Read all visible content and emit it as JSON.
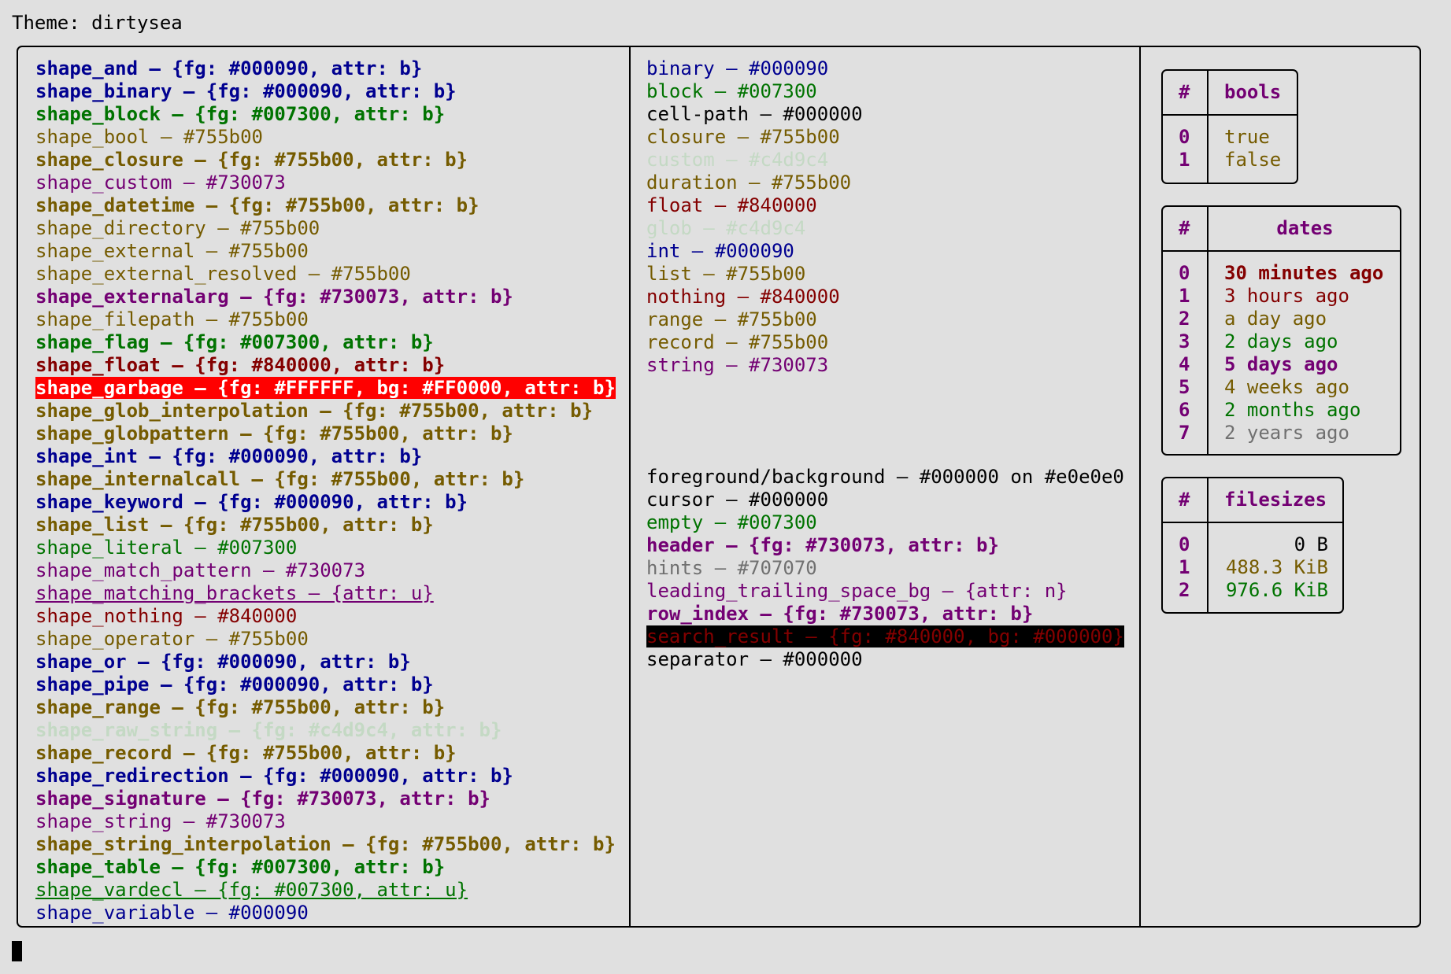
{
  "title": "Theme: dirtysea",
  "shapes": [
    {
      "text": "shape_and – {fg: #000090, attr: b}",
      "color": "#000090",
      "bold": true
    },
    {
      "text": "shape_binary – {fg: #000090, attr: b}",
      "color": "#000090",
      "bold": true
    },
    {
      "text": "shape_block – {fg: #007300, attr: b}",
      "color": "#007300",
      "bold": true
    },
    {
      "text": "shape_bool – #755b00",
      "color": "#755b00"
    },
    {
      "text": "shape_closure – {fg: #755b00, attr: b}",
      "color": "#755b00",
      "bold": true
    },
    {
      "text": "shape_custom – #730073",
      "color": "#730073"
    },
    {
      "text": "shape_datetime – {fg: #755b00, attr: b}",
      "color": "#755b00",
      "bold": true
    },
    {
      "text": "shape_directory – #755b00",
      "color": "#755b00"
    },
    {
      "text": "shape_external – #755b00",
      "color": "#755b00"
    },
    {
      "text": "shape_external_resolved – #755b00",
      "color": "#755b00"
    },
    {
      "text": "shape_externalarg – {fg: #730073, attr: b}",
      "color": "#730073",
      "bold": true
    },
    {
      "text": "shape_filepath – #755b00",
      "color": "#755b00"
    },
    {
      "text": "shape_flag – {fg: #007300, attr: b}",
      "color": "#007300",
      "bold": true
    },
    {
      "text": "shape_float – {fg: #840000, attr: b}",
      "color": "#840000",
      "bold": true
    },
    {
      "text": "shape_garbage – {fg: #FFFFFF, bg: #FF0000, attr: b}",
      "color": "#FFFFFF",
      "bg": "#FF0000",
      "bold": true
    },
    {
      "text": "shape_glob_interpolation – {fg: #755b00, attr: b}",
      "color": "#755b00",
      "bold": true
    },
    {
      "text": "shape_globpattern – {fg: #755b00, attr: b}",
      "color": "#755b00",
      "bold": true
    },
    {
      "text": "shape_int – {fg: #000090, attr: b}",
      "color": "#000090",
      "bold": true
    },
    {
      "text": "shape_internalcall – {fg: #755b00, attr: b}",
      "color": "#755b00",
      "bold": true
    },
    {
      "text": "shape_keyword – {fg: #000090, attr: b}",
      "color": "#000090",
      "bold": true
    },
    {
      "text": "shape_list – {fg: #755b00, attr: b}",
      "color": "#755b00",
      "bold": true
    },
    {
      "text": "shape_literal – #007300",
      "color": "#007300"
    },
    {
      "text": "shape_match_pattern – #730073",
      "color": "#730073"
    },
    {
      "text": "shape_matching_brackets – {attr: u}",
      "color": "#730073",
      "underline": true
    },
    {
      "text": "shape_nothing – #840000",
      "color": "#840000"
    },
    {
      "text": "shape_operator – #755b00",
      "color": "#755b00"
    },
    {
      "text": "shape_or – {fg: #000090, attr: b}",
      "color": "#000090",
      "bold": true
    },
    {
      "text": "shape_pipe – {fg: #000090, attr: b}",
      "color": "#000090",
      "bold": true
    },
    {
      "text": "shape_range – {fg: #755b00, attr: b}",
      "color": "#755b00",
      "bold": true
    },
    {
      "text": "shape_raw_string – {fg: #c4d9c4, attr: b}",
      "color": "#c4d9c4",
      "bold": true
    },
    {
      "text": "shape_record – {fg: #755b00, attr: b}",
      "color": "#755b00",
      "bold": true
    },
    {
      "text": "shape_redirection – {fg: #000090, attr: b}",
      "color": "#000090",
      "bold": true
    },
    {
      "text": "shape_signature – {fg: #730073, attr: b}",
      "color": "#730073",
      "bold": true
    },
    {
      "text": "shape_string – #730073",
      "color": "#730073"
    },
    {
      "text": "shape_string_interpolation – {fg: #755b00, attr: b}",
      "color": "#755b00",
      "bold": true
    },
    {
      "text": "shape_table – {fg: #007300, attr: b}",
      "color": "#007300",
      "bold": true
    },
    {
      "text": "shape_vardecl – {fg: #007300, attr: u}",
      "color": "#007300",
      "underline": true
    },
    {
      "text": "shape_variable – #000090",
      "color": "#000090"
    }
  ],
  "types": [
    {
      "text": "binary – #000090",
      "color": "#000090"
    },
    {
      "text": "block – #007300",
      "color": "#007300"
    },
    {
      "text": "cell-path – #000000",
      "color": "#000000"
    },
    {
      "text": "closure – #755b00",
      "color": "#755b00"
    },
    {
      "text": "custom – #c4d9c4",
      "color": "#c4d9c4"
    },
    {
      "text": "duration – #755b00",
      "color": "#755b00"
    },
    {
      "text": "float – #840000",
      "color": "#840000"
    },
    {
      "text": "glob – #c4d9c4",
      "color": "#c4d9c4"
    },
    {
      "text": "int – #000090",
      "color": "#000090"
    },
    {
      "text": "list – #755b00",
      "color": "#755b00"
    },
    {
      "text": "nothing – #840000",
      "color": "#840000"
    },
    {
      "text": "range – #755b00",
      "color": "#755b00"
    },
    {
      "text": "record – #755b00",
      "color": "#755b00"
    },
    {
      "text": "string – #730073",
      "color": "#730073"
    }
  ],
  "ui": [
    {
      "text": "foreground/background – #000000 on #e0e0e0",
      "color": "#000000"
    },
    {
      "text": "cursor – #000000",
      "color": "#000000"
    },
    {
      "text": "empty – #007300",
      "color": "#007300"
    },
    {
      "text": "header – {fg: #730073, attr: b}",
      "color": "#730073",
      "bold": true
    },
    {
      "text": "hints – #707070",
      "color": "#707070"
    },
    {
      "text": "leading_trailing_space_bg – {attr: n}",
      "color": "#730073"
    },
    {
      "text": "row_index – {fg: #730073, attr: b}",
      "color": "#730073",
      "bold": true
    },
    {
      "text": "search_result – {fg: #840000, bg: #000000}",
      "color": "#840000",
      "bg": "#000000"
    },
    {
      "text": "separator – #000000",
      "color": "#000000"
    }
  ],
  "tables": {
    "bools": {
      "hash": "#",
      "header": "bools",
      "rows": [
        {
          "idx": "0",
          "value": "true",
          "color": "#755b00"
        },
        {
          "idx": "1",
          "value": "false",
          "color": "#755b00"
        }
      ]
    },
    "dates": {
      "hash": "#",
      "header": "dates",
      "rows": [
        {
          "idx": "0",
          "value": "30 minutes ago",
          "color": "#840000",
          "bold": true
        },
        {
          "idx": "1",
          "value": "3 hours ago",
          "color": "#840000"
        },
        {
          "idx": "2",
          "value": "a day ago",
          "color": "#755b00"
        },
        {
          "idx": "3",
          "value": "2 days ago",
          "color": "#007300"
        },
        {
          "idx": "4",
          "value": "5 days ago",
          "color": "#730073",
          "bold": true
        },
        {
          "idx": "5",
          "value": "4 weeks ago",
          "color": "#755b00"
        },
        {
          "idx": "6",
          "value": "2 months ago",
          "color": "#007300"
        },
        {
          "idx": "7",
          "value": "2 years ago",
          "color": "#707070"
        }
      ]
    },
    "filesizes": {
      "hash": "#",
      "header": "filesizes",
      "rows": [
        {
          "idx": "0",
          "value": "0 B",
          "color": "#000000"
        },
        {
          "idx": "1",
          "value": "488.3 KiB",
          "color": "#755b00"
        },
        {
          "idx": "2",
          "value": "976.6 KiB",
          "color": "#007300"
        }
      ]
    }
  }
}
